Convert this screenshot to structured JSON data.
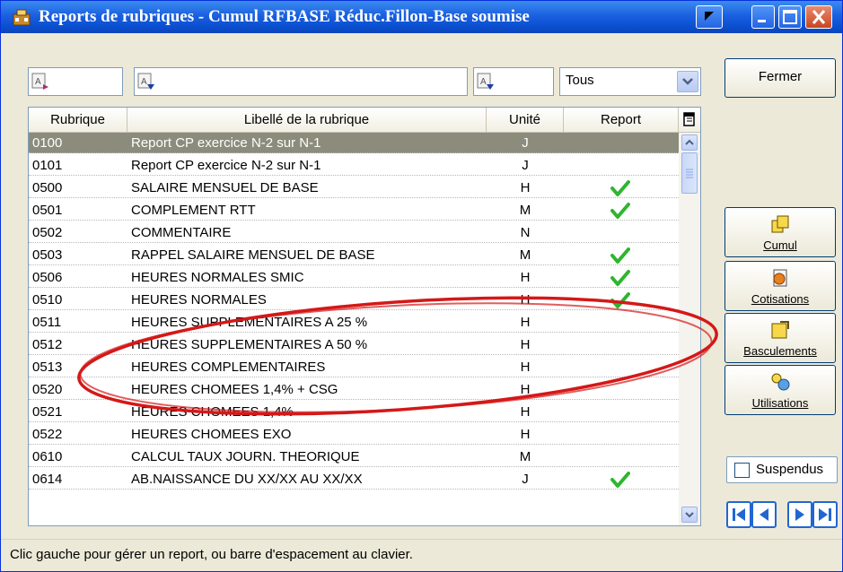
{
  "window": {
    "title": "Reports de rubriques - Cumul RFBASE Réduc.Fillon-Base soumise"
  },
  "filters": {
    "rubrique_value": "",
    "libelle_value": "",
    "unite_value": "",
    "report_value": "Tous"
  },
  "table": {
    "headers": {
      "rubrique": "Rubrique",
      "libelle": "Libellé de la rubrique",
      "unite": "Unité",
      "report": "Report"
    },
    "rows": [
      {
        "code": "0100",
        "label": "Report CP exercice N-2 sur N-1",
        "unit": "J",
        "report": false,
        "selected": true
      },
      {
        "code": "0101",
        "label": "Report CP exercice N-2 sur N-1",
        "unit": "J",
        "report": false,
        "selected": false
      },
      {
        "code": "0500",
        "label": "SALAIRE MENSUEL DE BASE",
        "unit": "H",
        "report": true,
        "selected": false
      },
      {
        "code": "0501",
        "label": "COMPLEMENT RTT",
        "unit": "M",
        "report": true,
        "selected": false
      },
      {
        "code": "0502",
        "label": "COMMENTAIRE",
        "unit": "N",
        "report": false,
        "selected": false
      },
      {
        "code": "0503",
        "label": "RAPPEL SALAIRE MENSUEL DE BASE",
        "unit": "M",
        "report": true,
        "selected": false
      },
      {
        "code": "0506",
        "label": "HEURES NORMALES SMIC",
        "unit": "H",
        "report": true,
        "selected": false
      },
      {
        "code": "0510",
        "label": "HEURES NORMALES",
        "unit": "H",
        "report": true,
        "selected": false
      },
      {
        "code": "0511",
        "label": "HEURES SUPPLEMENTAIRES A 25 %",
        "unit": "H",
        "report": false,
        "selected": false
      },
      {
        "code": "0512",
        "label": "HEURES SUPPLEMENTAIRES A 50 %",
        "unit": "H",
        "report": false,
        "selected": false
      },
      {
        "code": "0513",
        "label": "HEURES COMPLEMENTAIRES",
        "unit": "H",
        "report": false,
        "selected": false
      },
      {
        "code": "0520",
        "label": "HEURES CHOMEES 1,4% + CSG",
        "unit": "H",
        "report": false,
        "selected": false
      },
      {
        "code": "0521",
        "label": "HEURES CHOMEES 1,4%",
        "unit": "H",
        "report": false,
        "selected": false
      },
      {
        "code": "0522",
        "label": "HEURES CHOMEES EXO",
        "unit": "H",
        "report": false,
        "selected": false
      },
      {
        "code": "0610",
        "label": "CALCUL TAUX JOURN. THEORIQUE",
        "unit": "M",
        "report": false,
        "selected": false
      },
      {
        "code": "0614",
        "label": "AB.NAISSANCE DU XX/XX AU XX/XX",
        "unit": "J",
        "report": true,
        "selected": false
      }
    ]
  },
  "side": {
    "fermer": "Fermer",
    "cumul": "Cumul",
    "cotisations": "Cotisations",
    "basculements": "Basculements",
    "utilisations": "Utilisations",
    "suspendus": "Suspendus"
  },
  "status": {
    "text": "Clic gauche pour gérer un report, ou barre d'espacement au clavier."
  },
  "colors": {
    "titlebar": "#1a60e0",
    "selected_row": "#8c8c7c",
    "check": "#2fb52f",
    "annotation": "#d41818"
  }
}
